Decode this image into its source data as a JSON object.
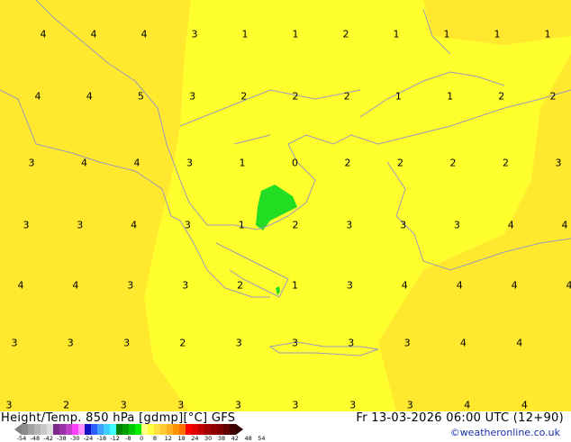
{
  "map": {
    "labels": [
      [
        "4",
        "4",
        "4",
        "3",
        "1",
        "1",
        "2",
        "1",
        "1",
        "1",
        "1"
      ],
      [
        "4",
        "4",
        "5",
        "3",
        "2",
        "2",
        "2",
        "1",
        "1",
        "2",
        "2"
      ],
      [
        "3",
        "4",
        "4",
        "3",
        "1",
        "0",
        "2",
        "2",
        "2",
        "2",
        "3"
      ],
      [
        "3",
        "3",
        "4",
        "3",
        "1",
        "2",
        "3",
        "3",
        "3",
        "4",
        "4"
      ],
      [
        "4",
        "4",
        "3",
        "3",
        "2",
        "1",
        "3",
        "4",
        "4",
        "4",
        "4"
      ],
      [
        "3",
        "3",
        "3",
        "2",
        "3",
        "3",
        "3",
        "3",
        "4",
        "4"
      ],
      [
        "3",
        "2",
        "3",
        "3",
        "3",
        "3",
        "3",
        "3",
        "4",
        "4"
      ]
    ],
    "colors": {
      "main": "#ffff2e",
      "warm": "#ffe82e",
      "green": "#22dd22",
      "coast": "#9a9ab8"
    }
  },
  "footer": {
    "title": "Height/Temp. 850 hPa [gdmp][°C] GFS",
    "date": "Fr 13-03-2026 06:00 UTC (12+90)",
    "credit": "©weatheronline.co.uk",
    "scale_ticks": [
      "-54",
      "-48",
      "-42",
      "-38",
      "-30",
      "-24",
      "-18",
      "-12",
      "-8",
      "0",
      "8",
      "12",
      "18",
      "24",
      "30",
      "38",
      "42",
      "48",
      "54"
    ],
    "scale_colors": [
      "#8c8c8c",
      "#a0a0a0",
      "#b4b4b4",
      "#c8c8c8",
      "#dcdcdc",
      "#7a2a8a",
      "#9a30a8",
      "#c040c8",
      "#ff40ff",
      "#ff90ff",
      "#1010c0",
      "#3060ff",
      "#40a0ff",
      "#40d0ff",
      "#40ffff",
      "#008000",
      "#00a000",
      "#00c800",
      "#00ee00",
      "#ffff80",
      "#ffff40",
      "#ffe040",
      "#ffc830",
      "#ffb020",
      "#ff9000",
      "#ff7000",
      "#ff0000",
      "#e00000",
      "#c00000",
      "#a00000",
      "#900000",
      "#800000",
      "#600000",
      "#400000"
    ]
  }
}
